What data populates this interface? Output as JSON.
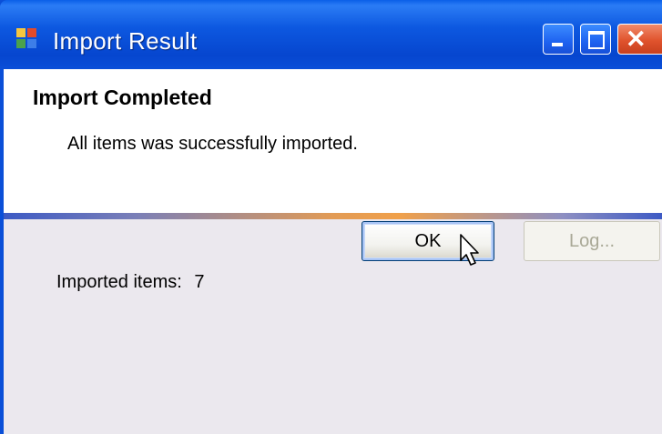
{
  "window": {
    "title": "Import Result",
    "icon": "app-window-icon",
    "controls": {
      "minimize": "minimize-icon",
      "maximize": "maximize-icon",
      "close": "close-icon",
      "close_glyph": "✕"
    }
  },
  "header": {
    "title": "Import Completed",
    "message": "All items was successfully imported."
  },
  "summary": {
    "label": "Imported items:",
    "value": "7"
  },
  "buttons": {
    "ok": "OK",
    "log": "Log..."
  },
  "colors": {
    "titlebar": "#0a4fd8",
    "close_button": "#e0532d",
    "separator_accent": "#f0a04a"
  }
}
